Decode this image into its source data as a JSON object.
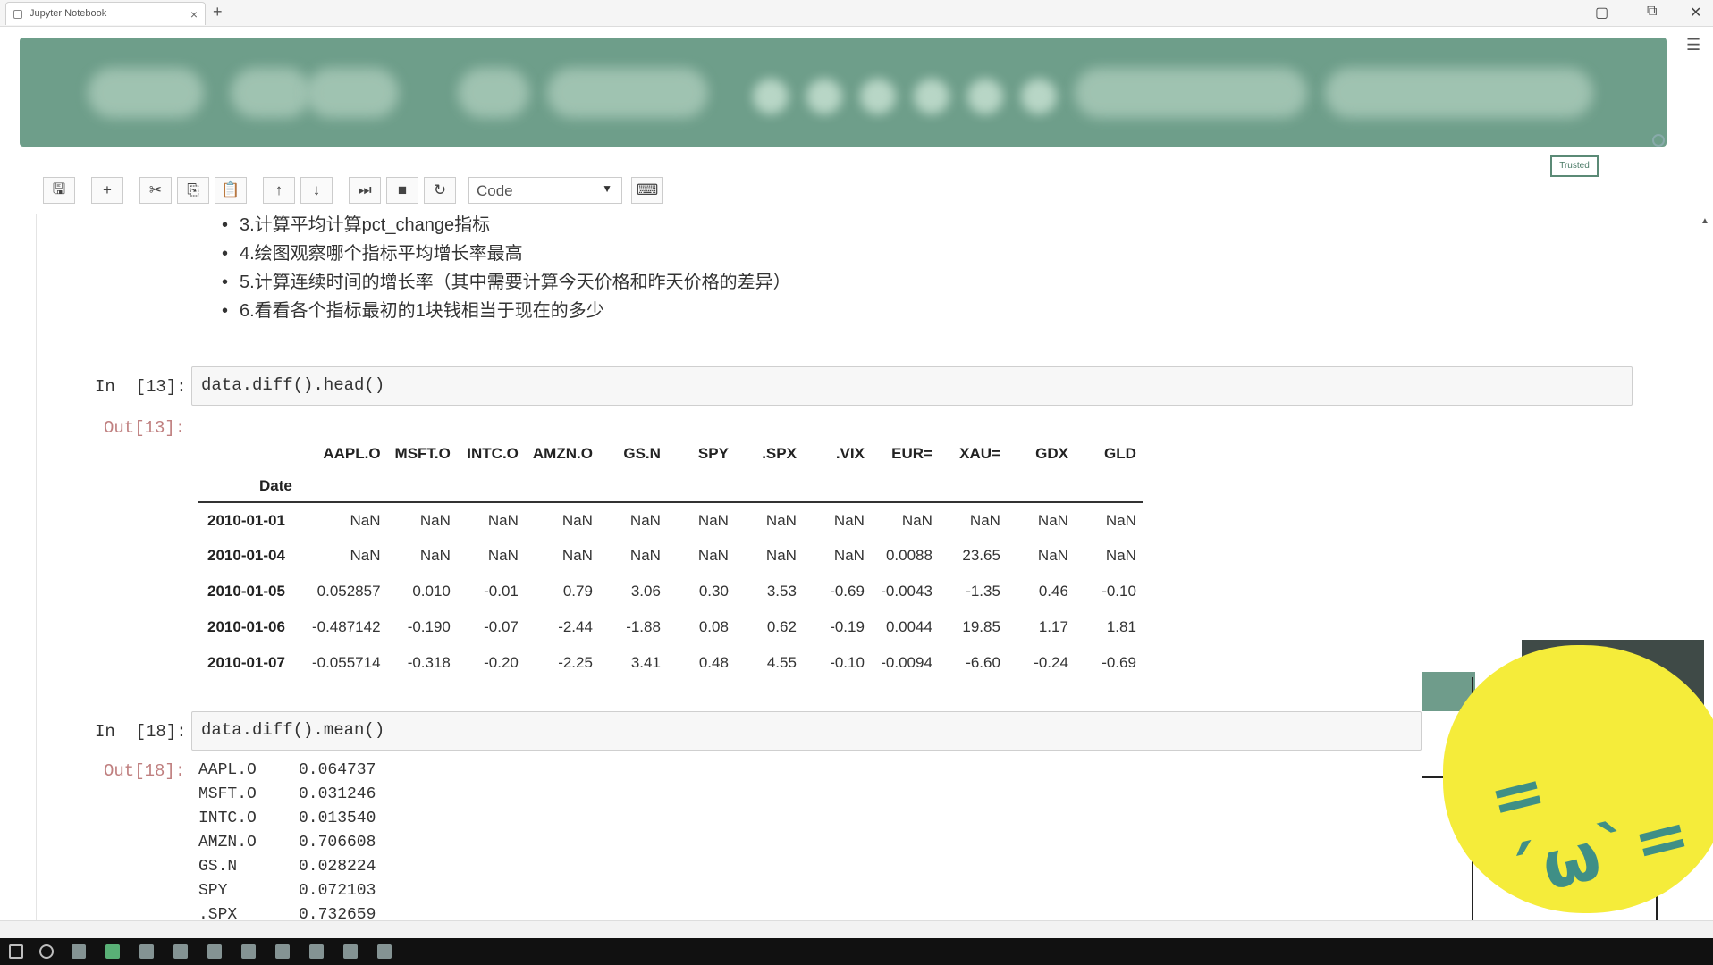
{
  "browser": {
    "tab_title": "Jupyter Notebook",
    "tab_close": "×",
    "new_tab": "+",
    "minimize": "▢",
    "maximize": "⧉",
    "close": "✕",
    "menu": "☰"
  },
  "header": {
    "trusted_badge": "Trusted"
  },
  "toolbar": {
    "save_icon": "🖫",
    "insert_icon": "+",
    "cut_icon": "✂",
    "copy_icon": "⎘",
    "paste_icon": "📋",
    "move_up_icon": "↑",
    "move_down_icon": "↓",
    "run_icon": "⏭",
    "stop_icon": "■",
    "restart_icon": "↻",
    "cell_type": "Code",
    "cell_type_caret": "▼",
    "keyboard_icon": "⌨"
  },
  "notebook": {
    "bullets": [
      "3.计算平均计算pct_change指标",
      "4.绘图观察哪个指标平均增长率最高",
      "5.计算连续时间的增长率（其中需要计算今天价格和昨天价格的差异）",
      "6.看看各个指标最初的1块钱相当于现在的多少"
    ],
    "cell13": {
      "in_prompt": "In  [13]:",
      "out_prompt": "Out[13]:",
      "code": "data.diff().head()"
    },
    "cell18": {
      "in_prompt": "In  [18]:",
      "out_prompt": "Out[18]:",
      "code": "data.diff().mean()"
    },
    "dataframe": {
      "columns": [
        "AAPL.O",
        "MSFT.O",
        "INTC.O",
        "AMZN.O",
        "GS.N",
        "SPY",
        ".SPX",
        ".VIX",
        "EUR=",
        "XAU=",
        "GDX",
        "GLD"
      ],
      "index_name": "Date",
      "rows": [
        {
          "date": "2010-01-01",
          "values": [
            "NaN",
            "NaN",
            "NaN",
            "NaN",
            "NaN",
            "NaN",
            "NaN",
            "NaN",
            "NaN",
            "NaN",
            "NaN",
            "NaN"
          ]
        },
        {
          "date": "2010-01-04",
          "values": [
            "NaN",
            "NaN",
            "NaN",
            "NaN",
            "NaN",
            "NaN",
            "NaN",
            "NaN",
            "0.0088",
            "23.65",
            "NaN",
            "NaN"
          ]
        },
        {
          "date": "2010-01-05",
          "values": [
            "0.052857",
            "0.010",
            "-0.01",
            "0.79",
            "3.06",
            "0.30",
            "3.53",
            "-0.69",
            "-0.0043",
            "-1.35",
            "0.46",
            "-0.10"
          ]
        },
        {
          "date": "2010-01-06",
          "values": [
            "-0.487142",
            "-0.190",
            "-0.07",
            "-2.44",
            "-1.88",
            "0.08",
            "0.62",
            "-0.19",
            "0.0044",
            "19.85",
            "1.17",
            "1.81"
          ]
        },
        {
          "date": "2010-01-07",
          "values": [
            "-0.055714",
            "-0.318",
            "-0.20",
            "-2.25",
            "3.41",
            "0.48",
            "4.55",
            "-0.10",
            "-0.0094",
            "-6.60",
            "-0.24",
            "-0.69"
          ]
        }
      ]
    },
    "series": [
      {
        "name": "AAPL.O",
        "value": "0.064737"
      },
      {
        "name": "MSFT.O",
        "value": "0.031246"
      },
      {
        "name": "INTC.O",
        "value": "0.013540"
      },
      {
        "name": "AMZN.O",
        "value": "0.706608"
      },
      {
        "name": "GS.N",
        "value": "0.028224"
      },
      {
        "name": "SPY",
        "value": "0.072103"
      },
      {
        "name": ".SPX",
        "value": "0.732659"
      }
    ]
  },
  "overlay": {
    "mascot_face": "=´ω`="
  }
}
